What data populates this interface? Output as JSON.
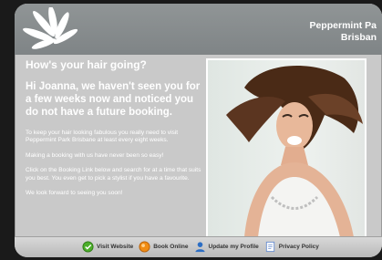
{
  "header": {
    "brand_line1": "Peppermint Pa",
    "brand_line2": "Brisban"
  },
  "content": {
    "greeting": "How's your hair going?",
    "lead": "Hi Joanna, we haven't seen you for a few weeks now and noticed you do not have a future booking.",
    "paragraphs": [
      "To keep your hair looking fabulous you really need to visit Peppermint Park Brisbane at least every eight weeks.",
      "Making a booking with us have never been so easy!",
      "Click on the Booking Link below and search for at a time that suits you best. You even get to pick a stylist if you have a favourite.",
      "We look forward to seeing you soon!"
    ]
  },
  "footer": {
    "links": [
      {
        "label": "Visit Website",
        "icon": "globe-icon",
        "color": "#4caf2a"
      },
      {
        "label": "Book Online",
        "icon": "book-online-icon",
        "color": "#f08c14"
      },
      {
        "label": "Update my Profile",
        "icon": "user-icon",
        "color": "#2c6ec4"
      },
      {
        "label": "Privacy Policy",
        "icon": "document-icon",
        "color": "#6a8fd0"
      }
    ]
  }
}
